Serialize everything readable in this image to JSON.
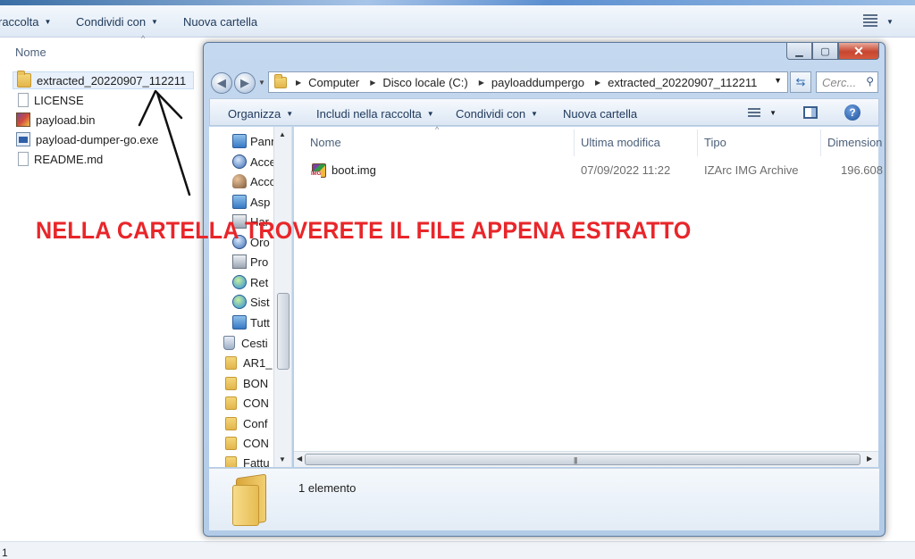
{
  "background_window": {
    "toolbar": {
      "items": [
        "raccolta",
        "Condividi con",
        "Nuova cartella"
      ]
    },
    "columns": {
      "name": "Nome",
      "modified": "Ultima modifica",
      "type": "Tipo",
      "size": "Dimensione"
    },
    "files": [
      {
        "name": "extracted_20220907_112211",
        "icon": "folder-icon",
        "selected": true
      },
      {
        "name": "LICENSE",
        "icon": "document-icon"
      },
      {
        "name": "payload.bin",
        "icon": "archive-icon"
      },
      {
        "name": "payload-dumper-go.exe",
        "icon": "executable-icon"
      },
      {
        "name": "README.md",
        "icon": "document-icon"
      }
    ],
    "status": "1"
  },
  "annotation": {
    "text": "NELLA CARTELLA TROVERETE IL FILE APPENA ESTRATTO",
    "color": "#e8262a"
  },
  "window": {
    "address": [
      "Computer",
      "Disco locale (C:)",
      "payloaddumpergo",
      "extracted_20220907_112211"
    ],
    "search_placeholder": "Cerc...",
    "commands": {
      "organize": "Organizza",
      "include": "Includi nella raccolta",
      "share": "Condividi con",
      "new_folder": "Nuova cartella"
    },
    "nav_items": [
      {
        "label": "Pann",
        "icon": "control-panel-icon"
      },
      {
        "label": "Acce",
        "icon": "ease-of-access-icon"
      },
      {
        "label": "Acco",
        "icon": "user-accounts-icon"
      },
      {
        "label": "Asp",
        "icon": "appearance-icon"
      },
      {
        "label": "Har",
        "icon": "hardware-icon"
      },
      {
        "label": "Oro",
        "icon": "clock-icon"
      },
      {
        "label": "Pro",
        "icon": "programs-icon"
      },
      {
        "label": "Ret",
        "icon": "network-icon"
      },
      {
        "label": "Sist",
        "icon": "system-icon"
      },
      {
        "label": "Tutt",
        "icon": "all-items-icon"
      },
      {
        "label": "Cesti",
        "icon": "recycle-bin-icon"
      },
      {
        "label": "AR1_",
        "icon": "folder-icon"
      },
      {
        "label": "BON",
        "icon": "folder-icon"
      },
      {
        "label": "CON",
        "icon": "folder-icon"
      },
      {
        "label": "Conf",
        "icon": "folder-icon"
      },
      {
        "label": "CON",
        "icon": "folder-icon"
      },
      {
        "label": "Fattu",
        "icon": "folder-icon"
      }
    ],
    "columns": {
      "name": "Nome",
      "modified": "Ultima modifica",
      "type": "Tipo",
      "size": "Dimension"
    },
    "file": {
      "name": "boot.img",
      "modified": "07/09/2022 11:22",
      "type": "IZArc IMG Archive",
      "size": "196.608"
    },
    "status": "1 elemento"
  }
}
